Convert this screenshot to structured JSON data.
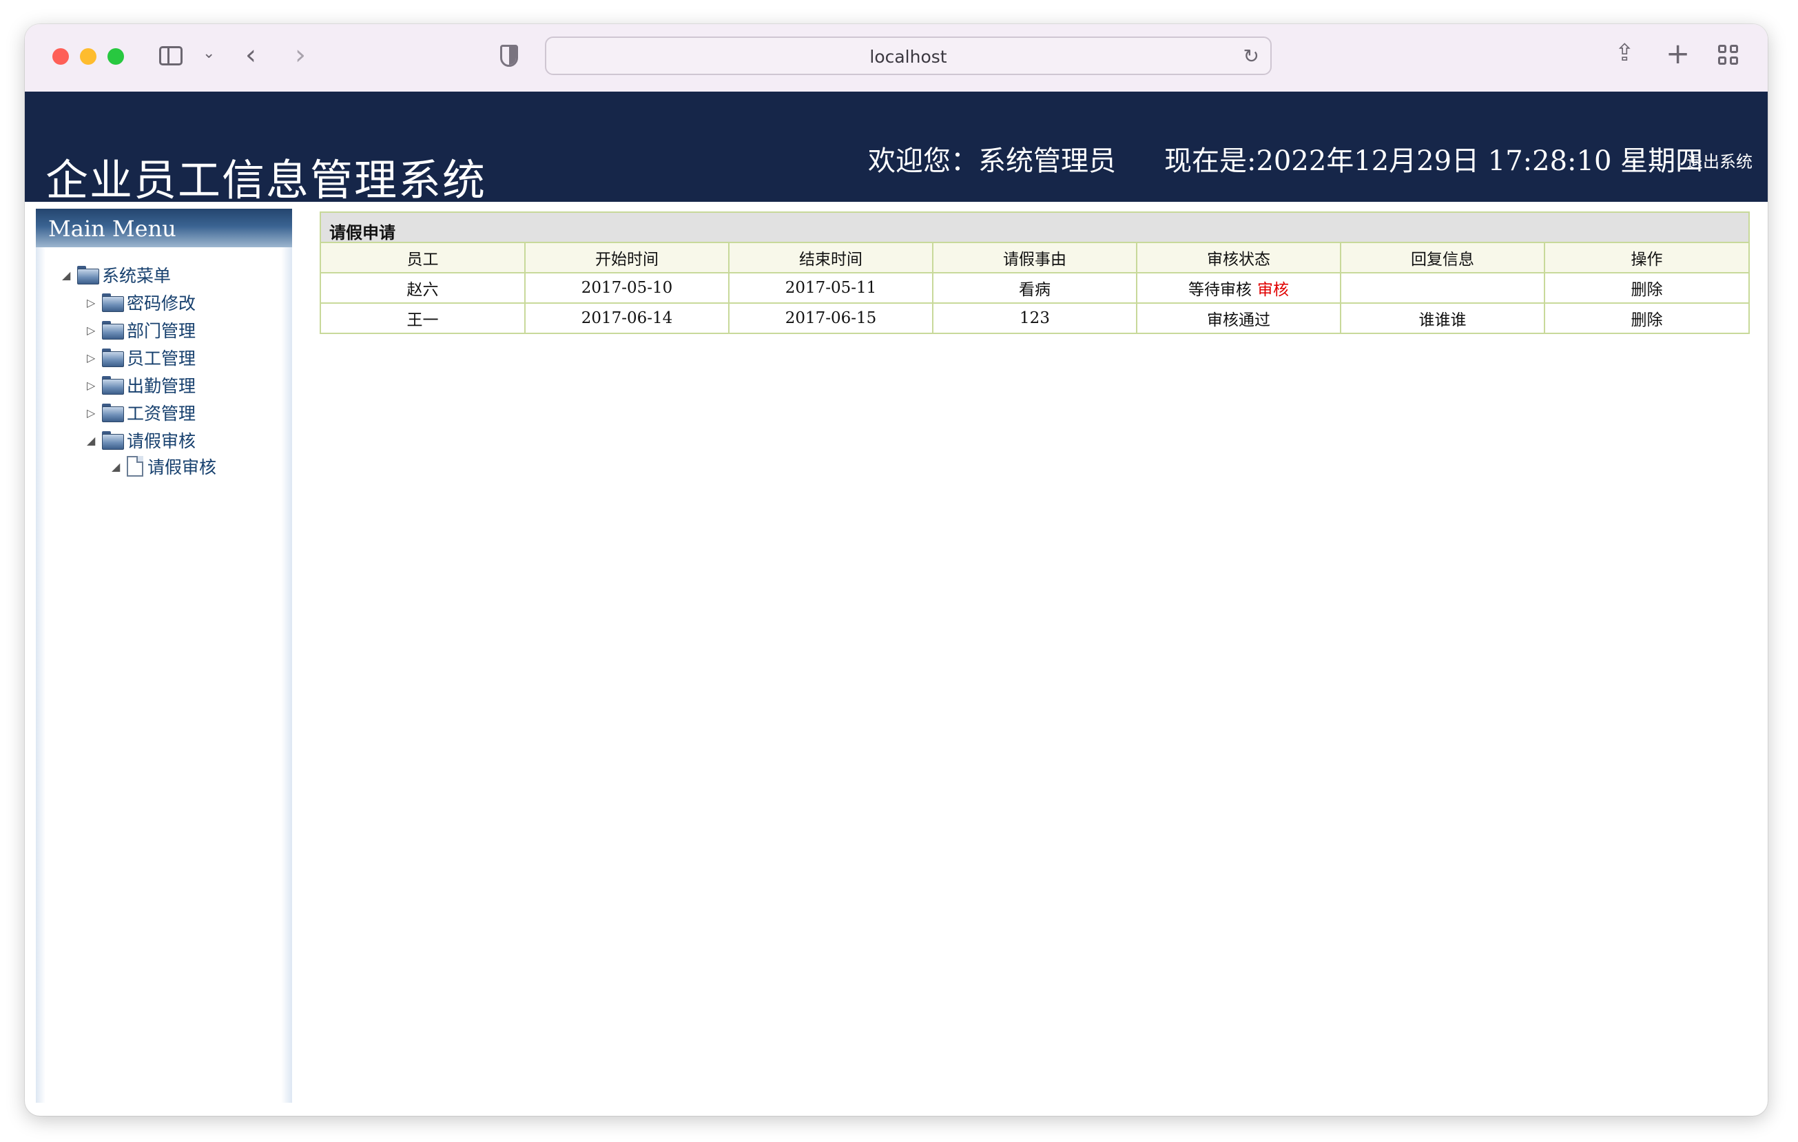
{
  "browser": {
    "url": "localhost"
  },
  "header": {
    "title": "企业员工信息管理系统",
    "welcome": "欢迎您：系统管理员",
    "clock": "现在是:2022年12月29日 17:28:10 星期四",
    "logout": "退出系统"
  },
  "menu": {
    "title": "Main Menu",
    "root": "系统菜单",
    "items": [
      {
        "label": "密码修改",
        "expanded": false
      },
      {
        "label": "部门管理",
        "expanded": false
      },
      {
        "label": "员工管理",
        "expanded": false
      },
      {
        "label": "出勤管理",
        "expanded": false
      },
      {
        "label": "工资管理",
        "expanded": false
      },
      {
        "label": "请假审核",
        "expanded": true
      }
    ],
    "child": "请假审核"
  },
  "table": {
    "title": "请假申请",
    "columns": [
      "员工",
      "开始时间",
      "结束时间",
      "请假事由",
      "审核状态",
      "回复信息",
      "操作"
    ],
    "rows": [
      {
        "employee": "赵六",
        "start": "2017-05-10",
        "end": "2017-05-11",
        "reason": "看病",
        "status": "等待审核",
        "action_review": "审核",
        "reply": "",
        "action": "删除"
      },
      {
        "employee": "王一",
        "start": "2017-06-14",
        "end": "2017-06-15",
        "reason": "123",
        "status": "审核通过",
        "action_review": "",
        "reply": "谁谁谁",
        "action": "删除"
      }
    ]
  },
  "colors": {
    "header_bg": "#162649",
    "table_border": "#c8d99a",
    "review_link": "#e00000"
  }
}
